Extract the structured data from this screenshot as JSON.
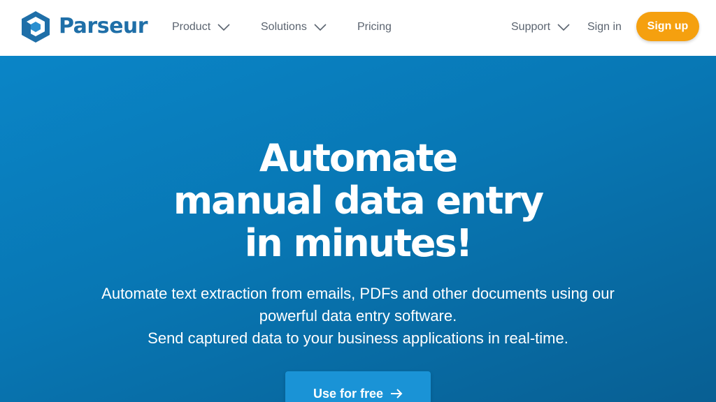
{
  "brand": {
    "name": "Parseur",
    "logo_color": "#1f6fa8"
  },
  "nav": {
    "product": "Product",
    "solutions": "Solutions",
    "pricing": "Pricing",
    "support": "Support",
    "signin": "Sign in",
    "signup": "Sign up",
    "signup_color": "#f5a00f",
    "dropdown_icon": "chevron-down-icon"
  },
  "hero": {
    "title_lines": [
      "Automate",
      "manual data entry",
      "in minutes!"
    ],
    "subtitle_lines": [
      "Automate text extraction from emails, PDFs and other documents using our",
      "powerful data entry software.",
      "Send captured data to your business applications in real-time."
    ],
    "cta_label": "Use for free",
    "cta_icon": "arrow-right-icon",
    "background_color": "#0877b4"
  }
}
